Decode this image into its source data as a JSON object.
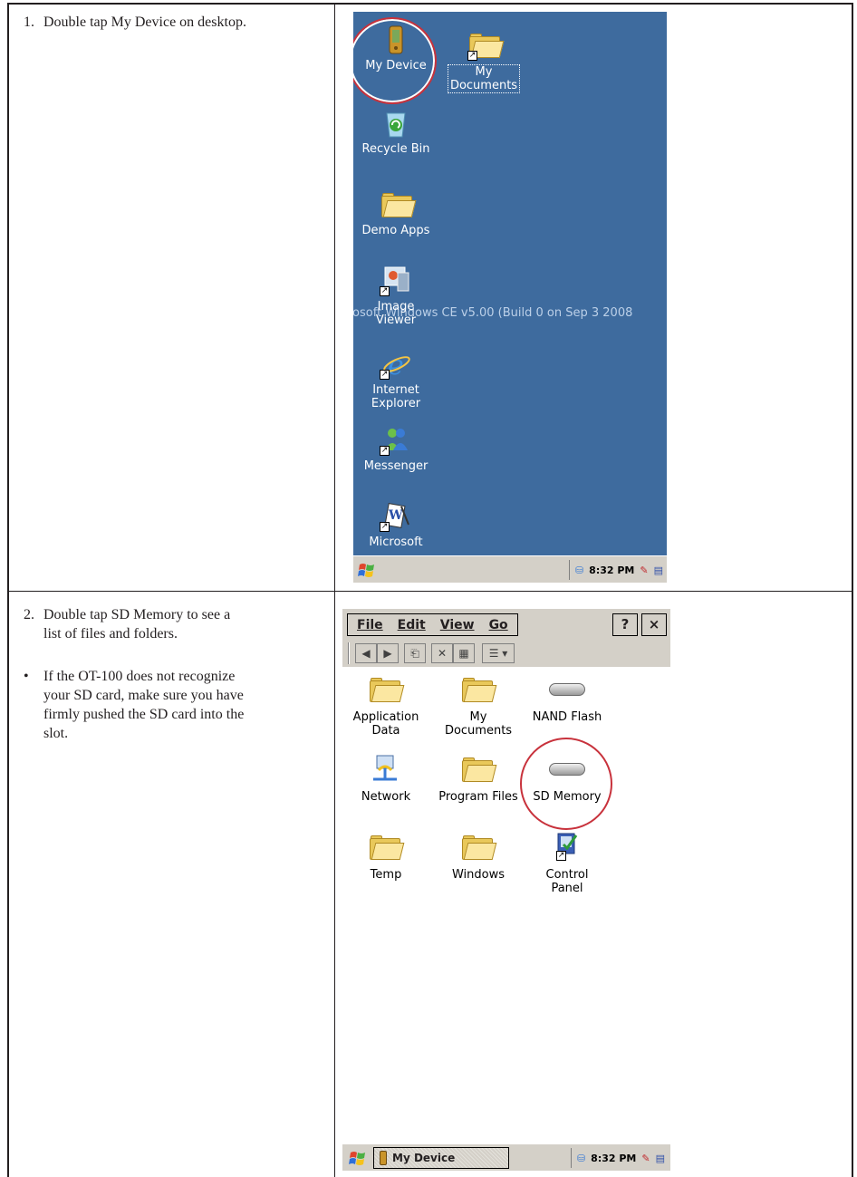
{
  "steps": [
    {
      "number": "1.",
      "text": "Double tap My Device on desktop."
    },
    {
      "number": "2.",
      "text_line1": "Double tap SD Memory to see a",
      "text_line2": "list of files and folders."
    }
  ],
  "note": {
    "bullet": "•",
    "lines": [
      "If the OT-100 does not recognize",
      "your SD card, make sure you have",
      "firmly pushed the SD card into the",
      "slot."
    ]
  },
  "desktop": {
    "icons": [
      {
        "label": "My Device"
      },
      {
        "label": "My\nDocuments"
      },
      {
        "label": "Recycle Bin"
      },
      {
        "label": "Demo Apps"
      },
      {
        "label": "Image\nViewer"
      },
      {
        "label": "Internet\nExplorer"
      },
      {
        "label": "Messenger"
      },
      {
        "label": "Microsoft"
      }
    ],
    "wallpaper_text": "rosoft Windows CE v5.00 (Build 0 on Sep  3 2008",
    "clock": "8:32 PM"
  },
  "explorer": {
    "menu": [
      "File",
      "Edit",
      "View",
      "Go"
    ],
    "help_button": "?",
    "close_button": "×",
    "items": [
      {
        "label": "Application\nData",
        "icon": "folder"
      },
      {
        "label": "My\nDocuments",
        "icon": "folder"
      },
      {
        "label": "NAND Flash",
        "icon": "drive"
      },
      {
        "label": "Network",
        "icon": "network"
      },
      {
        "label": "Program Files",
        "icon": "folder"
      },
      {
        "label": "SD Memory",
        "icon": "drive"
      },
      {
        "label": "Temp",
        "icon": "folder"
      },
      {
        "label": "Windows",
        "icon": "folder"
      },
      {
        "label": "Control\nPanel",
        "icon": "control-panel"
      }
    ],
    "taskbar_button": "My Device",
    "clock": "8:32 PM"
  },
  "colors": {
    "desktop_bg": "#3e6b9e",
    "highlight_circle": "#c8323c",
    "chrome": "#d4d0c8"
  }
}
